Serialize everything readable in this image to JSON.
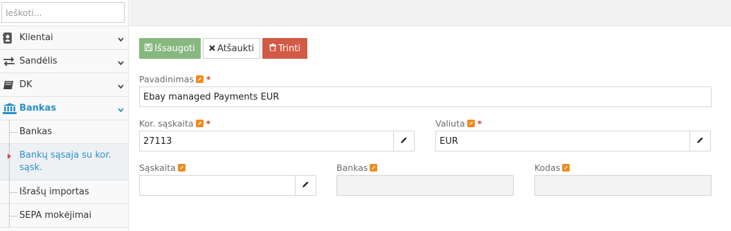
{
  "sidebar": {
    "search_placeholder": "Ieškoti...",
    "items": [
      {
        "label": "Klientai",
        "icon": "user-book-icon"
      },
      {
        "label": "Sandėlis",
        "icon": "exchange-arrows-icon"
      },
      {
        "label": "DK",
        "icon": "book-icon"
      },
      {
        "label": "Bankas",
        "icon": "bank-icon",
        "active": true
      }
    ],
    "subitems": [
      {
        "label": "Bankas"
      },
      {
        "label": "Bankų sąsaja su kor. sąsk.",
        "active": true
      },
      {
        "label": "Išrašų importas"
      },
      {
        "label": "SEPA mokėjimai"
      }
    ]
  },
  "toolbar": {
    "save_label": "Išsaugoti",
    "cancel_label": "Atšaukti",
    "delete_label": "Trinti"
  },
  "form": {
    "name_label": "Pavadinimas",
    "name_value": "Ebay managed Payments EUR",
    "kor_account_label": "Kor. sąskaita",
    "kor_account_value": "27113",
    "currency_label": "Valiuta",
    "currency_value": "EUR",
    "account_label": "Sąskaita",
    "account_value": "",
    "bank_label": "Bankas",
    "bank_value": "",
    "code_label": "Kodas",
    "code_value": "",
    "required_mark": "*"
  },
  "colors": {
    "accent": "#2a8fc7",
    "save": "#87b87f",
    "delete": "#d15b47",
    "edit_icon": "#f28a1b",
    "required": "#d0453b"
  }
}
